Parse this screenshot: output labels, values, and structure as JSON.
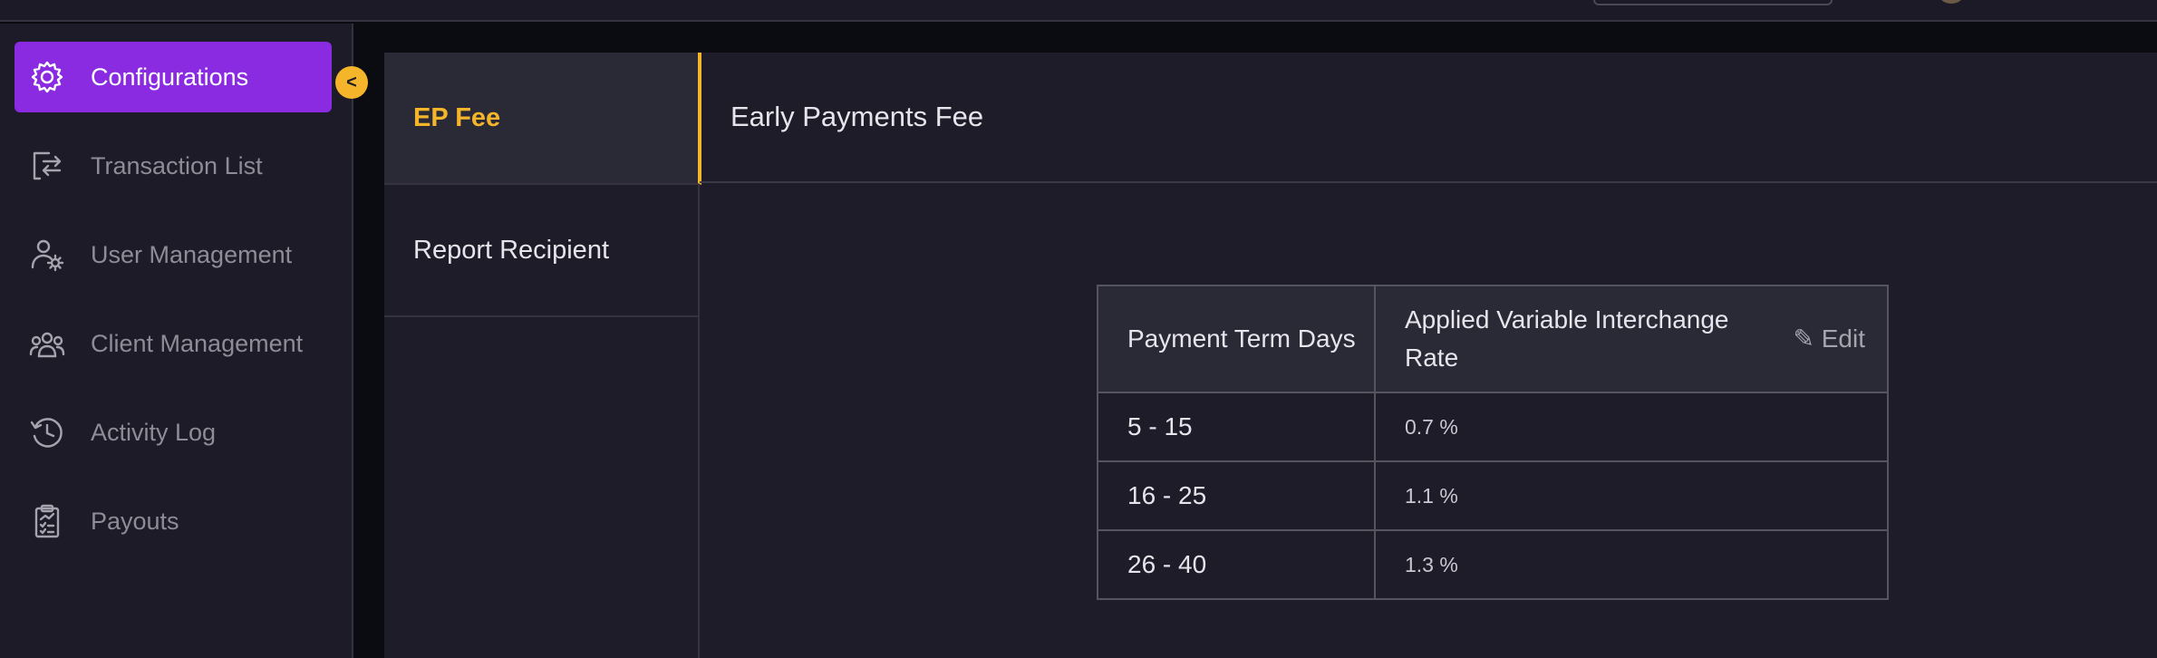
{
  "sidebar": {
    "items": [
      {
        "label": "Configurations",
        "icon": "gear-icon",
        "active": true
      },
      {
        "label": "Transaction List",
        "icon": "transfer-icon",
        "active": false
      },
      {
        "label": "User Management",
        "icon": "user-gear-icon",
        "active": false
      },
      {
        "label": "Client Management",
        "icon": "group-icon",
        "active": false
      },
      {
        "label": "Activity Log",
        "icon": "history-clock-icon",
        "active": false
      },
      {
        "label": "Payouts",
        "icon": "clipboard-chart-icon",
        "active": false
      }
    ],
    "collapse_glyph": "<"
  },
  "subnav": {
    "items": [
      {
        "label": "EP Fee",
        "active": true
      },
      {
        "label": "Report Recipient",
        "active": false
      }
    ]
  },
  "content": {
    "title": "Early Payments Fee",
    "table": {
      "headers": [
        "Payment Term Days",
        "Applied Variable Interchange Rate"
      ],
      "edit_label": "✎ Edit",
      "rows": [
        [
          "5 - 15",
          "0.7 %"
        ],
        [
          "16 - 25",
          "1.1 %"
        ],
        [
          "26 - 40",
          "1.3 %"
        ]
      ]
    }
  },
  "colors": {
    "accent_purple": "#8a2be2",
    "accent_yellow": "#f4b52b",
    "background": "#1c1b27"
  }
}
